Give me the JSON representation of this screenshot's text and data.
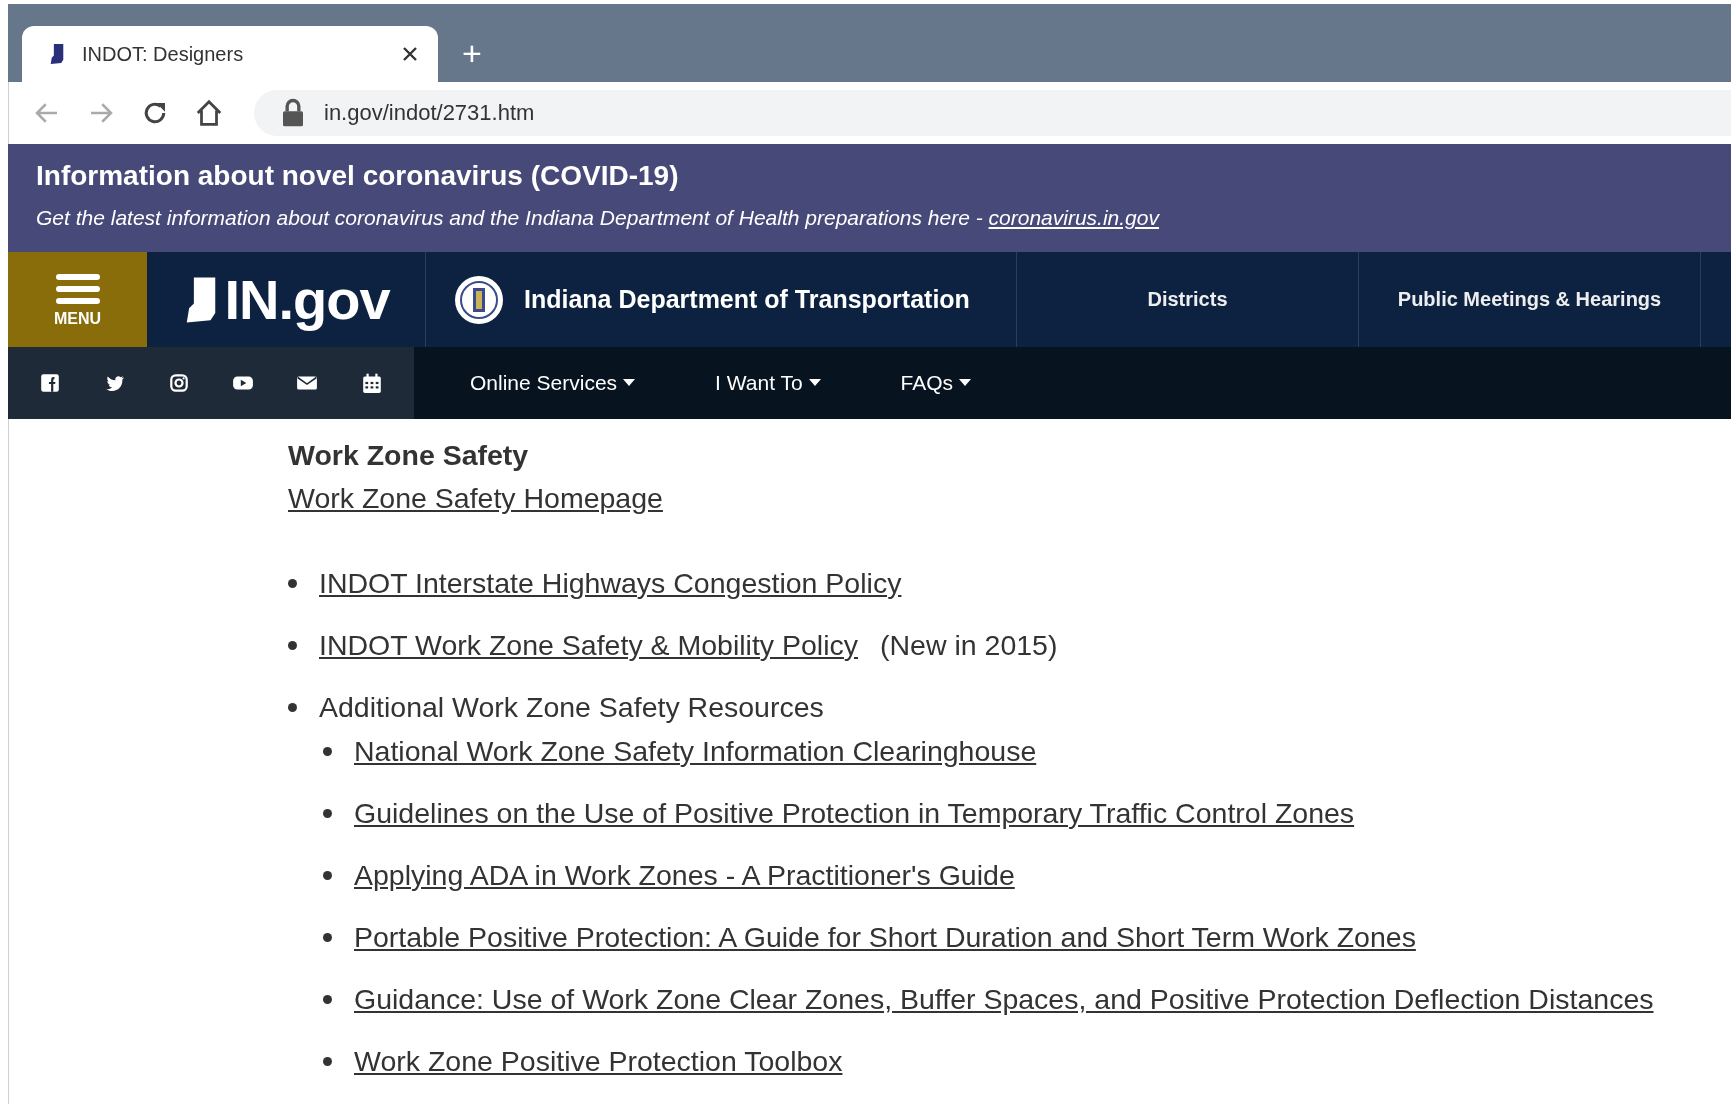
{
  "browser": {
    "tab": {
      "title": "INDOT: Designers",
      "selected": true
    },
    "new_tab": "+",
    "address": "in.gov/indot/2731.htm"
  },
  "alert": {
    "title": "Information about novel coronavirus (COVID-19)",
    "text": "Get the latest information about coronavirus and the Indiana Department of Health preparations here - ",
    "link": "coronavirus.in.gov"
  },
  "header": {
    "menu_label": "MENU",
    "logo": "IN.gov",
    "agency": "Indiana Department of Transportation",
    "nav": [
      "Districts",
      "Public Meetings & Hearings"
    ]
  },
  "subnav": {
    "social": [
      {
        "kind": "facebook"
      },
      {
        "kind": "twitter"
      },
      {
        "kind": "instagram"
      },
      {
        "kind": "youtube"
      },
      {
        "kind": "email"
      },
      {
        "kind": "calendar"
      }
    ],
    "menus": [
      "Online Services",
      "I Want To",
      "FAQs"
    ]
  },
  "content": {
    "heading": "Work Zone Safety",
    "home_link": "Work Zone Safety Homepage",
    "items": [
      {
        "link": "INDOT Interstate Highways Congestion Policy"
      },
      {
        "link": "INDOT Work Zone Safety & Mobility Policy",
        "note": "(New in 2015)"
      },
      {
        "text": "Additional Work Zone Safety Resources",
        "children": [
          {
            "link": "National Work Zone Safety Information Clearinghouse"
          },
          {
            "link": "Guidelines on the Use of Positive Protection in Temporary Traffic Control Zones"
          },
          {
            "link": "Applying ADA in Work Zones - A Practitioner's Guide"
          },
          {
            "link": "Portable Positive Protection: A Guide for Short Duration and Short Term Work Zones"
          },
          {
            "link": "Guidance: Use of Work Zone Clear Zones, Buffer Spaces, and Positive Protection Deflection Distances"
          },
          {
            "link": "Work Zone Positive Protection Toolbox"
          }
        ]
      }
    ]
  }
}
